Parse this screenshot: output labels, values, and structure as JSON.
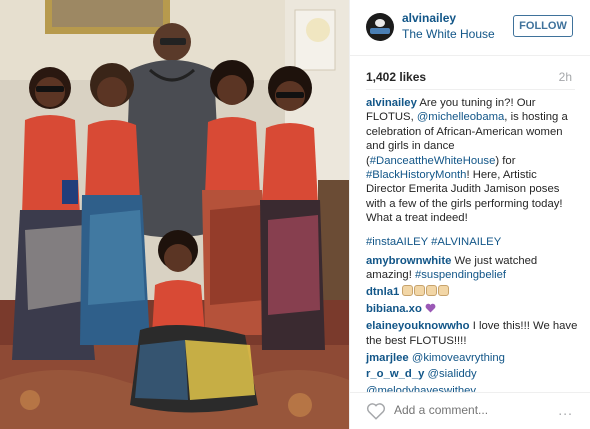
{
  "post": {
    "username": "alvinailey",
    "location": "The White House",
    "follow_label": "FOLLOW",
    "likes": "1,402 likes",
    "time": "2h",
    "caption": {
      "user": "alvinailey",
      "text_1": " Are you tuning in?! Our FLOTUS, ",
      "mention": "@michelleobama",
      "text_2": ", is hosting a celebration of African-American women and girls in dance (",
      "tag_1": "#DanceattheWhiteHouse",
      "text_3": ") for ",
      "tag_2": "#BlackHistoryMonth",
      "text_4": "! Here, Artistic Director Emerita Judith Jamison poses with a few of the girls performing today! What a treat indeed!"
    },
    "hashtags": "#instaAILEY #ALVINAILEY",
    "comments": [
      {
        "user": "amybrownwhite",
        "text": " We just watched amazing! ",
        "tag": "#suspendingbelief"
      },
      {
        "user": "dtnla1",
        "text": " "
      },
      {
        "user": "bibiana.xo",
        "text": " "
      },
      {
        "user": "elaineyouknowwho",
        "text": " I love this!!! We have the best FLOTUS!!!!"
      },
      {
        "user": "jmarjlee",
        "text": " ",
        "mention": "@kimoveavrything"
      },
      {
        "user": "r_o_w_d_y",
        "text": " ",
        "mention": "@sialiddy"
      },
      {
        "user": "",
        "text": "",
        "mention": "@melodyhaveswithev"
      }
    ],
    "add_comment_placeholder": "Add a comment...",
    "more_label": "∙∙∙"
  },
  "colors": {
    "link": "#125688",
    "follow": "#3f729b",
    "muted": "#a5a7aa",
    "text": "#262626"
  }
}
